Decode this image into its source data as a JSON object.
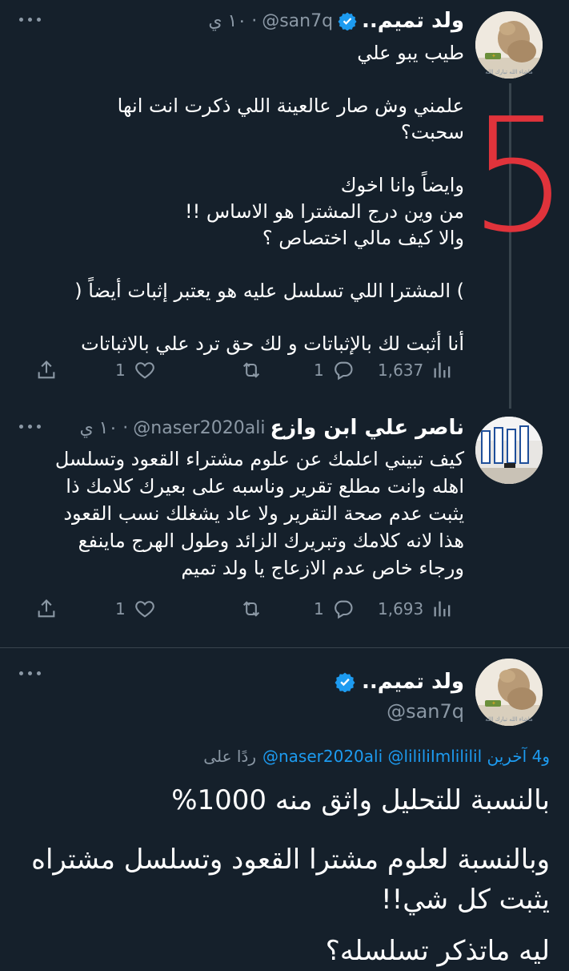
{
  "tweets": [
    {
      "name": "ولد تميم..",
      "handle": "@san7q",
      "time": "١٠ ي",
      "verified": true,
      "text": "طيب يبو علي\n\nعلمني وش صار عالعينة اللي ذكرت انت انها سحبت؟\n\nوايضاً وانا اخوك\nمن وين درج المشترا هو الاساس !!\nوالا كيف مالي اختصاص ؟\n\n( المشترا اللي تسلسل عليه هو يعتبر إثبات أيضاً )\n\nأنا أثبت لك بالإثباتات و لك حق ترد علي بالاثباتات",
      "overlay_number": "5",
      "avatar_caption": "ماشاء الله تبارك الله",
      "replies": "1",
      "retweets": "",
      "likes": "1",
      "views": "1,637"
    },
    {
      "name": "ناصر علي ابن وازع",
      "handle": "@naser2020ali",
      "time": "١٠ ي",
      "verified": false,
      "text": "كيف تبيني اعلمك عن علوم مشتراء القعود وتسلسل اهله وانت مطلع تقرير وناسبه على بعيرك كلامك ذا يثبت عدم صحة التقرير ولا عاد يشغلك نسب القعود هذا لانه كلامك وتبريرك الزائد وطول الهرج ماينفع ورجاء خاص عدم الازعاج يا ولد تميم",
      "replies": "1",
      "retweets": "",
      "likes": "1",
      "views": "1,693"
    }
  ],
  "focused_tweet": {
    "name": "ولد تميم..",
    "handle": "@san7q",
    "reply_prefix": "ردًا على",
    "reply_to": "@naser2020ali @lililiImlililil و4 آخرين",
    "avatar_caption": "ماشاء الله تبارك الله",
    "paragraph1": "بالنسبة للتحليل واثق منه 1000%",
    "paragraph2": "وبالنسبة لعلوم مشترا القعود وتسلسل مشتراه يثبت كل شي!!",
    "paragraph3": "ليه ماتذكر تسلسله؟"
  },
  "colors": {
    "background": "#15202b",
    "text": "#ffffff",
    "muted": "#8b98a5",
    "link": "#1d9bf0",
    "verified": "#1d9bf0",
    "overlay": "#e0333b",
    "divider": "#38444d"
  },
  "icons": [
    "more-icon",
    "verified-badge-icon",
    "reply-icon",
    "retweet-icon",
    "like-icon",
    "views-icon",
    "share-icon"
  ]
}
